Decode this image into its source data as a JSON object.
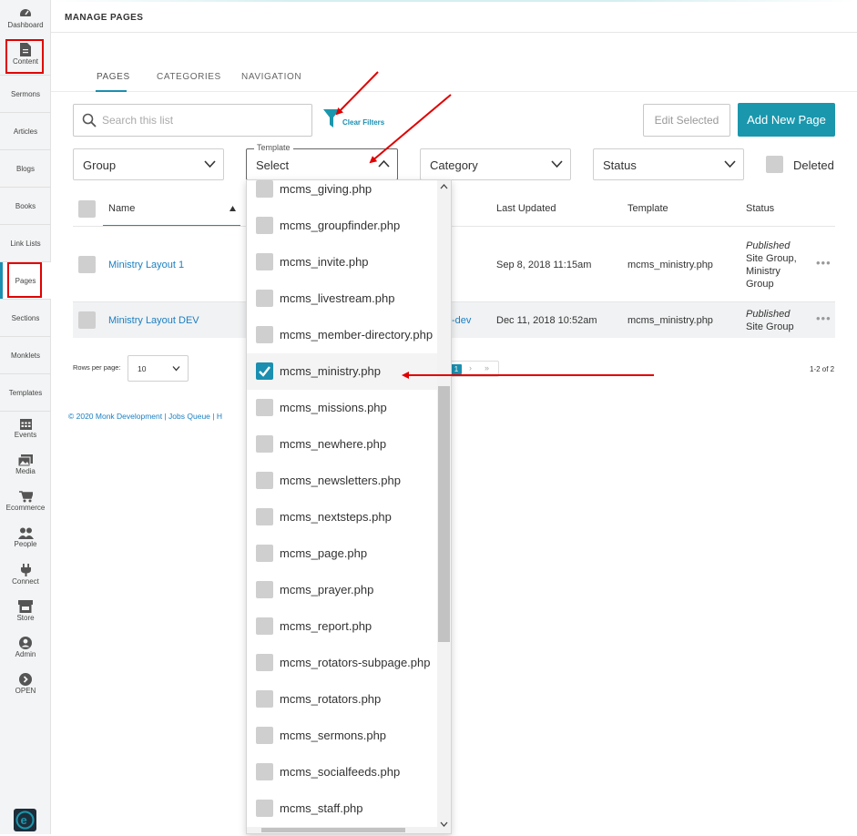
{
  "sidebar": {
    "items": [
      {
        "label": "Dashboard",
        "icon": "dashboard-icon"
      },
      {
        "label": "Content",
        "icon": "document-icon"
      },
      {
        "label": "Sermons"
      },
      {
        "label": "Articles"
      },
      {
        "label": "Blogs"
      },
      {
        "label": "Books"
      },
      {
        "label": "Link Lists"
      },
      {
        "label": "Pages"
      },
      {
        "label": "Sections"
      },
      {
        "label": "Monklets"
      },
      {
        "label": "Templates"
      },
      {
        "label": "Events",
        "icon": "calendar-icon"
      },
      {
        "label": "Media",
        "icon": "images-icon"
      },
      {
        "label": "Ecommerce",
        "icon": "cart-icon"
      },
      {
        "label": "People",
        "icon": "people-icon"
      },
      {
        "label": "Connect",
        "icon": "plug-icon"
      },
      {
        "label": "Store",
        "icon": "store-icon"
      },
      {
        "label": "Admin",
        "icon": "user-circle-icon"
      },
      {
        "label": "OPEN",
        "icon": "arrow-circle-icon"
      }
    ],
    "logo": "e-logo"
  },
  "header": {
    "title": "MANAGE PAGES"
  },
  "tabs": [
    {
      "label": "PAGES",
      "active": true
    },
    {
      "label": "CATEGORIES"
    },
    {
      "label": "NAVIGATION"
    }
  ],
  "toolbar": {
    "search_placeholder": "Search this list",
    "clear_filters": "Clear Filters",
    "edit_selected": "Edit Selected",
    "add_new_page": "Add New Page"
  },
  "filters": {
    "group": "Group",
    "template_legend": "Template",
    "template_value": "Select",
    "category": "Category",
    "status": "Status",
    "deleted": "Deleted"
  },
  "table": {
    "columns": {
      "name": "Name",
      "last_updated": "Last Updated",
      "template": "Template",
      "status": "Status"
    },
    "rows": [
      {
        "name": "Ministry Layout 1",
        "slug_fragment": "",
        "last_updated": "Sep 8, 2018 11:15am",
        "template": "mcms_ministry.php",
        "status_italic": "Published",
        "status_groups": [
          "Site Group,",
          "Ministry",
          "Group"
        ]
      },
      {
        "name": "Ministry Layout DEV",
        "slug_fragment": "-dev",
        "last_updated": "Dec 11, 2018 10:52am",
        "template": "mcms_ministry.php",
        "status_italic": "Published",
        "status_groups": [
          "Site Group"
        ]
      }
    ],
    "rows_per_page_label": "Rows per page:",
    "rows_per_page": "10",
    "current_page": "1",
    "range": "1-2 of 2"
  },
  "footer": {
    "text": "© 2020 Monk Development  |  Jobs Queue  |  H"
  },
  "template_dropdown": {
    "options": [
      {
        "label": "mcms_giving.php",
        "checked": false
      },
      {
        "label": "mcms_groupfinder.php",
        "checked": false
      },
      {
        "label": "mcms_invite.php",
        "checked": false
      },
      {
        "label": "mcms_livestream.php",
        "checked": false
      },
      {
        "label": "mcms_member-directory.php",
        "checked": false
      },
      {
        "label": "mcms_ministry.php",
        "checked": true
      },
      {
        "label": "mcms_missions.php",
        "checked": false
      },
      {
        "label": "mcms_newhere.php",
        "checked": false
      },
      {
        "label": "mcms_newsletters.php",
        "checked": false
      },
      {
        "label": "mcms_nextsteps.php",
        "checked": false
      },
      {
        "label": "mcms_page.php",
        "checked": false
      },
      {
        "label": "mcms_prayer.php",
        "checked": false
      },
      {
        "label": "mcms_report.php",
        "checked": false
      },
      {
        "label": "mcms_rotators-subpage.php",
        "checked": false
      },
      {
        "label": "mcms_rotators.php",
        "checked": false
      },
      {
        "label": "mcms_sermons.php",
        "checked": false
      },
      {
        "label": "mcms_socialfeeds.php",
        "checked": false
      },
      {
        "label": "mcms_staff.php",
        "checked": false
      }
    ]
  },
  "colors": {
    "accent": "#1a97ad",
    "link": "#1a7fc1",
    "annotation": "#e00000"
  }
}
